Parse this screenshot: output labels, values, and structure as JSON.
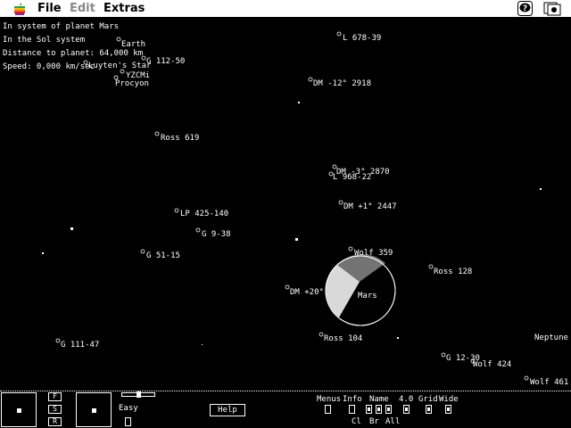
{
  "menubar": {
    "items": [
      {
        "label": "File",
        "enabled": true
      },
      {
        "label": "Edit",
        "enabled": false
      },
      {
        "label": "Extras",
        "enabled": true
      }
    ]
  },
  "info": {
    "line1": "In system of planet Mars",
    "line2": "In the Sol system",
    "line3": "Distance to planet: 64,000 km",
    "line4": "Speed: 0,000 km/sec"
  },
  "stars": [
    {
      "name": "Earth"
    },
    {
      "name": "G 112-50"
    },
    {
      "name": "Luyten's Star"
    },
    {
      "name": "YZCMi"
    },
    {
      "name": "Procyon"
    },
    {
      "name": "L 678-39"
    },
    {
      "name": "DM -12° 2918"
    },
    {
      "name": "Ross 619"
    },
    {
      "name": "DM -3° 2870"
    },
    {
      "name": "L 968-22"
    },
    {
      "name": "DM +1° 2447"
    },
    {
      "name": "LP 425-140"
    },
    {
      "name": "G 9-38"
    },
    {
      "name": "G 51-15"
    },
    {
      "name": "Wolf 359"
    },
    {
      "name": "DM +20°"
    },
    {
      "name": "Ross 128"
    },
    {
      "name": "Ross 104"
    },
    {
      "name": "G 111-47"
    },
    {
      "name": "G 12-30"
    },
    {
      "name": "Wolf 424"
    },
    {
      "name": "Wolf 461"
    },
    {
      "name": "Neptune"
    }
  ],
  "planet": {
    "name": "Mars"
  },
  "panel": {
    "btn_f": "F",
    "btn_s": "S",
    "btn_r": "R",
    "easy_label": "Easy",
    "help_label": "Help",
    "menus_label": "Menus",
    "info_label": "Info",
    "name_label": "Name",
    "mag_label": "4.0",
    "grid_label": "Grid",
    "wide_label": "Wide",
    "cl_label": "Cl",
    "br_label": "Br",
    "all_label": "All"
  }
}
